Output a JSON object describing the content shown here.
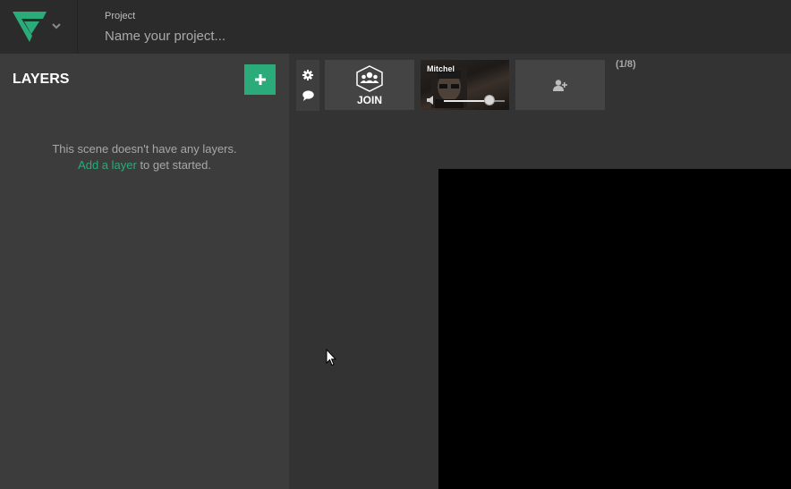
{
  "header": {
    "project_label": "Project",
    "project_placeholder": "Name your project...",
    "project_value": ""
  },
  "colors": {
    "accent": "#2bab7a",
    "topbar_bg": "#2b2b2b",
    "panel_bg": "#3c3c3c",
    "stage_bg": "#333333",
    "canvas_bg": "#000000"
  },
  "icons": {
    "logo": "app-logo-icon",
    "logo_menu": "chevron-down-icon",
    "add_layer": "plus-icon",
    "settings": "gear-icon",
    "chat": "chat-bubble-icon",
    "join": "group-icon",
    "volume": "volume-icon",
    "invite": "add-user-icon",
    "cursor": "mouse-pointer-icon"
  },
  "layers": {
    "title": "LAYERS",
    "empty_line1": "This scene doesn't have any layers.",
    "add_link": "Add a layer",
    "empty_line2_suffix": " to get started."
  },
  "guests": {
    "join_label": "JOIN",
    "camera_name": "Mitchel",
    "volume_level": 0.75,
    "count_label": "(1/8)"
  }
}
